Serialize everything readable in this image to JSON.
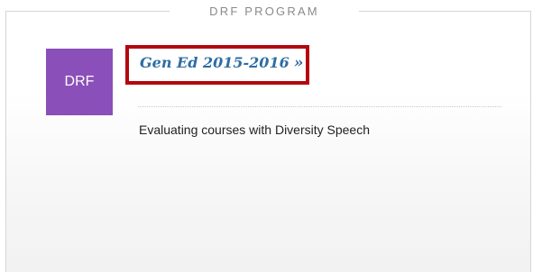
{
  "section": {
    "title": "DRF PROGRAM"
  },
  "program": {
    "badge_text": "DRF",
    "badge_color": "#8a4fb8",
    "link_label": "Gen Ed 2015-2016",
    "link_chevron": "»",
    "link_color": "#2f6da3",
    "highlight_color": "#b3060f",
    "description": "Evaluating courses with Diversity Speech"
  }
}
